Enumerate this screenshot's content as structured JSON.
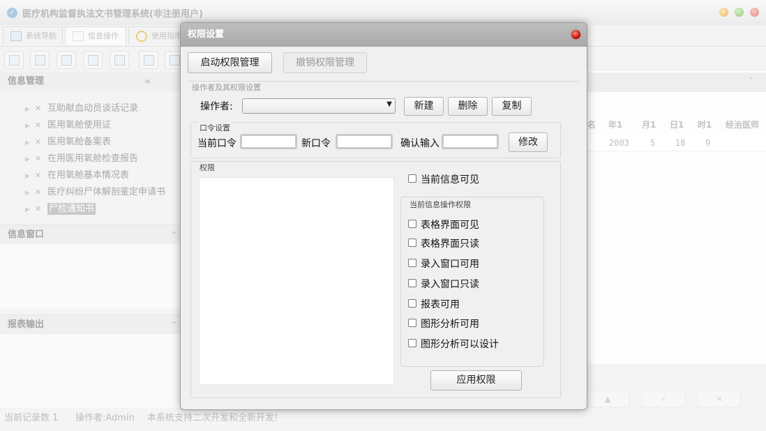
{
  "app": {
    "title": "医疗机构监督执法文书管理系统(非注册用户)"
  },
  "tabs": [
    "系统导航",
    "信息操作",
    "使用指南"
  ],
  "left_pane": {
    "info_title": "信息管理",
    "collapse_symbol": "«",
    "tree_items": [
      "互助献血动员谈话记录",
      "医用氧舱使用证",
      "医用氧舱备案表",
      "在用医用氧舱检查报告",
      "在用氧舱基本情况表",
      "医疗纠纷尸体解剖鉴定申请书",
      "尸检通知书"
    ],
    "window_title": "信息窗口",
    "report_title": "报表输出"
  },
  "grid": {
    "headers": [
      "名",
      "年1",
      "月1",
      "日1",
      "时1",
      "经治医师"
    ],
    "row": [
      "2003",
      "5",
      "18",
      "9"
    ]
  },
  "status": {
    "record_count": "当前记录数 1",
    "operator": "操作者:Admin",
    "notice": "本系统支持二次开发和全新开发!"
  },
  "dialog": {
    "title": "权限设置",
    "enable_button": "启动权限管理",
    "revoke_button": "撤销权限管理",
    "operator_group": "操作者及其权限设置",
    "operator_label": "操作者:",
    "operator_value": "",
    "new_button": "新建",
    "delete_button": "删除",
    "copy_button": "复制",
    "password_group": "口令设置",
    "current_pw_label": "当前口令",
    "new_pw_label": "新口令",
    "confirm_label": "确认输入",
    "modify_button": "修改",
    "permission_group": "权限",
    "current_visible": "当前信息可见",
    "ops_group": "当前信息操作权限",
    "checkboxes": [
      "表格界面可见",
      "表格界面只读",
      "录入窗口可用",
      "录入窗口只读",
      "报表可用",
      "图形分析可用",
      "图形分析可以设计"
    ],
    "apply_button": "应用权限"
  }
}
